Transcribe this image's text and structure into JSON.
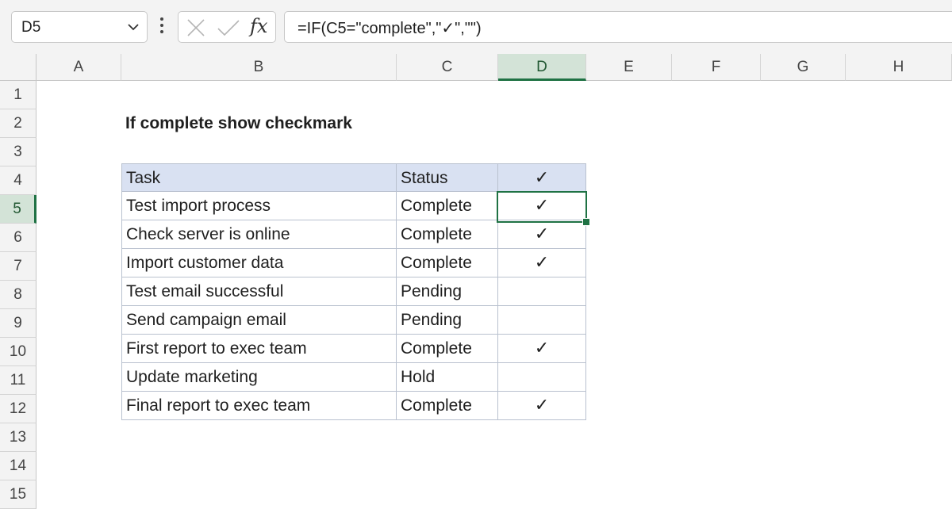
{
  "name_box": {
    "value": "D5"
  },
  "formula_bar": {
    "cancel_icon": "x-icon",
    "enter_icon": "check-icon",
    "function_label": "fx",
    "formula": "=IF(C5=\"complete\",\"✓\",\"\")"
  },
  "columns": [
    "A",
    "B",
    "C",
    "D",
    "E",
    "F",
    "G",
    "H"
  ],
  "active_column": "D",
  "rows": [
    "1",
    "2",
    "3",
    "4",
    "5",
    "6",
    "7",
    "8",
    "9",
    "10",
    "11",
    "12",
    "13",
    "14",
    "15"
  ],
  "active_row": "5",
  "sheet": {
    "title": "If complete show checkmark",
    "table": {
      "headers": [
        "Task",
        "Status",
        "✓"
      ],
      "rows": [
        {
          "task": "Test import process",
          "status": "Complete",
          "mark": "✓"
        },
        {
          "task": "Check server is online",
          "status": "Complete",
          "mark": "✓"
        },
        {
          "task": "Import customer data",
          "status": "Complete",
          "mark": "✓"
        },
        {
          "task": "Test email successful",
          "status": "Pending",
          "mark": ""
        },
        {
          "task": "Send campaign email",
          "status": "Pending",
          "mark": ""
        },
        {
          "task": "First report to exec team",
          "status": "Complete",
          "mark": "✓"
        },
        {
          "task": "Update marketing",
          "status": "Hold",
          "mark": ""
        },
        {
          "task": "Final report to exec team",
          "status": "Complete",
          "mark": "✓"
        }
      ]
    }
  },
  "colors": {
    "accent": "#1f7244",
    "header_fill": "#d9e1f2"
  }
}
